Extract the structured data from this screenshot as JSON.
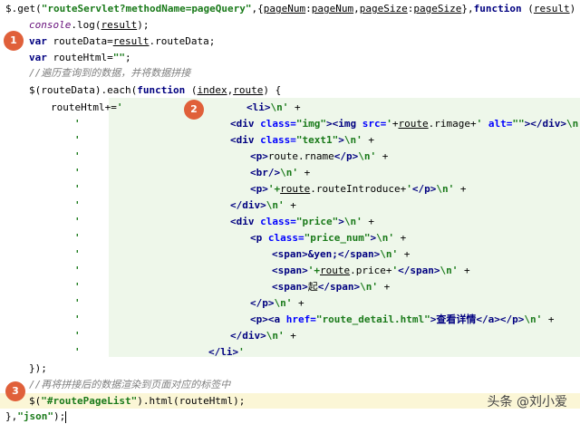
{
  "badges": [
    "1",
    "2",
    "3"
  ],
  "code": {
    "l01": [
      "$.get(",
      "\"routeServlet?methodName=pageQuery\"",
      ",{",
      "pageNum",
      ":",
      "pageNum",
      ",",
      "pageSize",
      ":",
      "pageSize",
      "},",
      "function",
      " (",
      "result",
      ") {"
    ],
    "l02": [
      "console",
      ".log(",
      "result",
      ");"
    ],
    "l03": [
      "var",
      " routeData=",
      "result",
      ".routeData;"
    ],
    "l04": [
      "var",
      " routeHtml=",
      "\"\"",
      ";"
    ],
    "l05": [
      "//遍历查询到的数据，并将数据拼接"
    ],
    "l06": [
      "$",
      "(routeData).each(",
      "function",
      " (",
      "index",
      ",",
      "route",
      ") {"
    ],
    "l07": [
      "routeHtml+=",
      "'",
      "<li>",
      "\\n'",
      " +"
    ],
    "l08": [
      "'",
      "<div ",
      "class=",
      "\"img\"",
      "><img ",
      "src=",
      "'",
      "+",
      "route",
      ".rimage+",
      "' ",
      "alt=",
      "\"\"",
      "></div>",
      "\\n'",
      " +"
    ],
    "l09": [
      "'",
      "<div ",
      "class=",
      "\"text1\"",
      ">",
      "\\n'",
      " +"
    ],
    "l10": [
      "'",
      "<p>",
      "route.rname",
      "</p>",
      "\\n'",
      " +"
    ],
    "l11": [
      "'",
      "<br/>",
      "\\n'",
      " +"
    ],
    "l12": [
      "'",
      "<p>",
      "'+",
      "route",
      ".routeIntroduce+",
      "'",
      "</p>",
      "\\n'",
      " +"
    ],
    "l13": [
      "'",
      "</div>",
      "\\n'",
      " +"
    ],
    "l14": [
      "'",
      "<div ",
      "class=",
      "\"price\"",
      ">",
      "\\n'",
      " +"
    ],
    "l15": [
      "'",
      "<p ",
      "class=",
      "\"price_num\"",
      ">",
      "\\n'",
      " +"
    ],
    "l16": [
      "'",
      "<span>",
      "&yen;",
      "</span>",
      "\\n'",
      " +"
    ],
    "l17": [
      "'",
      "<span>",
      "'+",
      "route",
      ".price+",
      "'",
      "</span>",
      "\\n'",
      " +"
    ],
    "l18": [
      "'",
      "<span>",
      "起",
      "</span>",
      "\\n'",
      " +"
    ],
    "l19": [
      "'",
      "</p>",
      "\\n'",
      " +"
    ],
    "l20": [
      "'",
      "<p>",
      "<a ",
      "href=",
      "\"route_detail.html\"",
      ">查看详情</a>",
      "</p>",
      "\\n'",
      " +"
    ],
    "l21": [
      "'",
      "</div>",
      "\\n'",
      " +"
    ],
    "l22": [
      "'",
      "</li>",
      "'"
    ],
    "l23": [
      "});"
    ],
    "l24": [
      "//再将拼接后的数据渲染到页面对应的标签中"
    ],
    "l25": [
      "$",
      "(",
      "\"#routePageList\"",
      ").html(routeHtml);"
    ],
    "l26": [
      "},",
      "\"json\"",
      ");"
    ]
  },
  "watermark": "头条 @刘小爱"
}
